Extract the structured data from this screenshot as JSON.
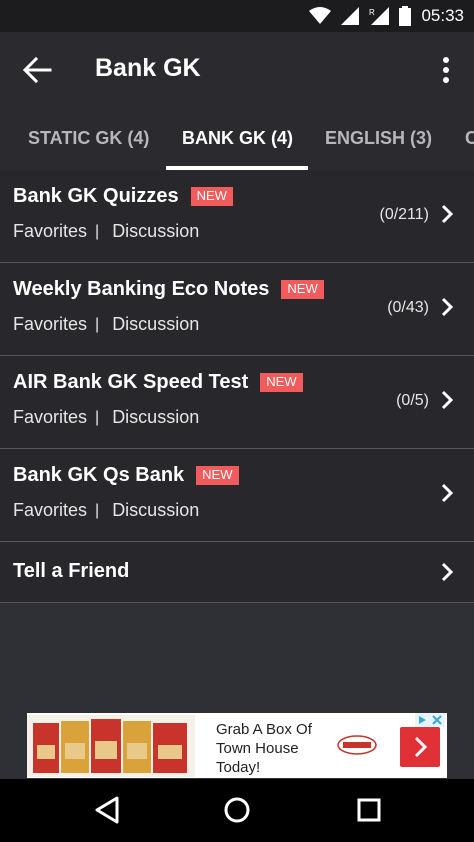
{
  "status": {
    "time": "05:33"
  },
  "appbar": {
    "title": "Bank GK"
  },
  "tabs": [
    {
      "label": "STATIC GK  (4)"
    },
    {
      "label": "BANK GK  (4)"
    },
    {
      "label": "ENGLISH  (3)"
    },
    {
      "label": "C"
    }
  ],
  "rows": [
    {
      "title": "Bank GK Quizzes",
      "badge": "NEW",
      "favorites": "Favorites",
      "separator": "|",
      "discussion": "Discussion",
      "count": "(0/211)"
    },
    {
      "title": "Weekly Banking Eco Notes",
      "badge": "NEW",
      "favorites": "Favorites",
      "separator": "|",
      "discussion": "Discussion",
      "count": "(0/43)"
    },
    {
      "title": "AIR Bank GK Speed Test",
      "badge": "NEW",
      "favorites": "Favorites",
      "separator": "|",
      "discussion": "Discussion",
      "count": "(0/5)"
    },
    {
      "title": "Bank GK Qs Bank",
      "badge": "NEW",
      "favorites": "Favorites",
      "separator": "|",
      "discussion": "Discussion",
      "count": ""
    },
    {
      "title": "Tell a Friend"
    }
  ],
  "ad": {
    "text": "Grab A Box Of Town House Today!",
    "logo": "TOWN HOUSE"
  },
  "icons": {
    "back": "arrow-left-icon",
    "menu": "more-vert-icon",
    "chevron": "chevron-right-icon"
  },
  "colors": {
    "badge": "#f15b5b",
    "background": "#2f2f36",
    "row": "#28282c",
    "ad_button": "#e03236"
  }
}
